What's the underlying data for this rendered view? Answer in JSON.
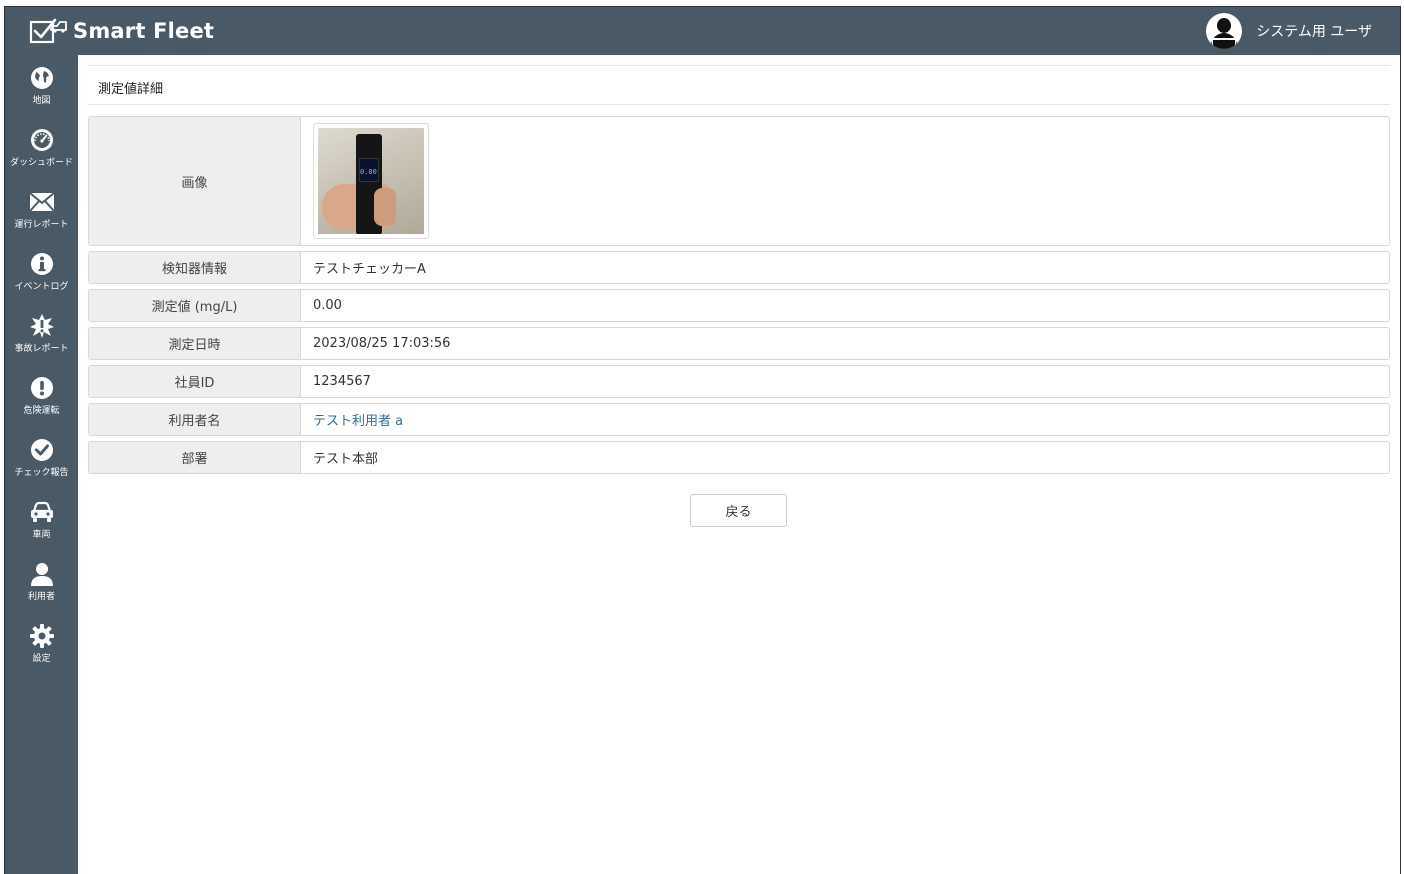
{
  "app": {
    "brand_name": "Smart Fleet",
    "user_name": "システム用 ユーザ"
  },
  "sidebar": {
    "items": [
      {
        "label": "地図",
        "icon": "globe-icon"
      },
      {
        "label": "ダッシュボード",
        "icon": "dashboard-icon"
      },
      {
        "label": "運行レポート",
        "icon": "envelope-icon"
      },
      {
        "label": "イベントログ",
        "icon": "info-icon"
      },
      {
        "label": "事故レポート",
        "icon": "accident-icon"
      },
      {
        "label": "危険運転",
        "icon": "exclamation-icon"
      },
      {
        "label": "チェック報告",
        "icon": "check-icon"
      },
      {
        "label": "車両",
        "icon": "car-icon"
      },
      {
        "label": "利用者",
        "icon": "user-icon"
      },
      {
        "label": "設定",
        "icon": "gear-icon"
      }
    ]
  },
  "page": {
    "title": "測定値詳細"
  },
  "detail": {
    "image_label": "画像",
    "rows": [
      {
        "label": "検知器情報",
        "value": "テストチェッカーA"
      },
      {
        "label": "測定値 (mg/L)",
        "value": "0.00"
      },
      {
        "label": "測定日時",
        "value": "2023/08/25 17:03:56"
      },
      {
        "label": "社員ID",
        "value": "1234567"
      },
      {
        "label": "利用者名",
        "value": "テスト利用者 a"
      },
      {
        "label": "部署",
        "value": "テスト本部"
      }
    ],
    "photo_digits": "0.00"
  },
  "actions": {
    "back_label": "戻る"
  },
  "colors": {
    "sidebar_bg": "#4a5966",
    "link": "#2e6da4",
    "label_bg": "#eeeeee"
  }
}
